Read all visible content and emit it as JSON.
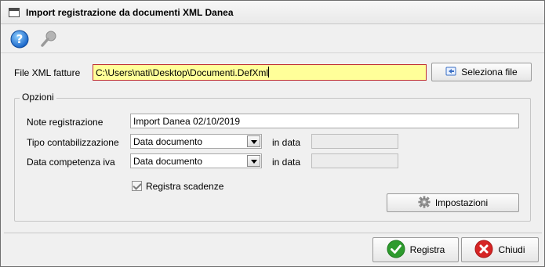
{
  "window": {
    "title": "Import registrazione da documenti XML Danea"
  },
  "toolbar": {
    "help_icon": "help-icon",
    "tool_icon": "key-icon"
  },
  "file": {
    "label": "File XML fatture",
    "value": "C:\\Users\\nati\\Desktop\\Documenti.DefXml",
    "select_label": "Seleziona file"
  },
  "options": {
    "group_label": "Opzioni",
    "note_label": "Note registrazione",
    "note_value": "Import Danea 02/10/2019",
    "tipo_label": "Tipo contabilizzazione",
    "tipo_value": "Data documento",
    "tipo_in_data_label": "in data",
    "tipo_in_data_value": "",
    "competenza_label": "Data competenza iva",
    "competenza_value": "Data documento",
    "competenza_in_data_label": "in data",
    "competenza_in_data_value": "",
    "scadenze_label": "Registra scadenze",
    "scadenze_checked": true,
    "settings_label": "Impostazioni"
  },
  "footer": {
    "register_label": "Registra",
    "close_label": "Chiudi"
  },
  "colors": {
    "highlight_field": "#ffff99",
    "field_border": "#c03030",
    "ok_green": "#2e9b2e",
    "close_red": "#d62424"
  }
}
